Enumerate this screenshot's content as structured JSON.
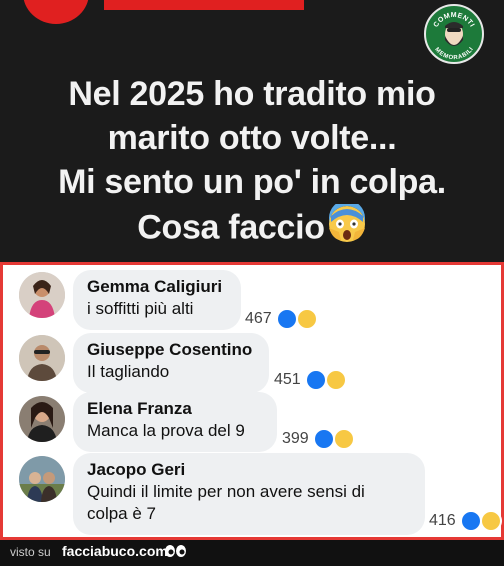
{
  "logo": {
    "text_top": "COMMENTI",
    "text_bottom": "MEMORABILI"
  },
  "post": {
    "lines": [
      "Nel 2025 ho tradito mio",
      "marito otto volte...",
      "Mi sento un po' in colpa.",
      "Cosa faccio"
    ],
    "emoji": "screaming-face-emoji"
  },
  "comments": [
    {
      "name": "Gemma Caligiuri",
      "text": "i soffitti più alti",
      "count": "467"
    },
    {
      "name": "Giuseppe Cosentino",
      "text": "Il tagliando",
      "count": "451"
    },
    {
      "name": "Elena Franza",
      "text": "Manca la prova del 9",
      "count": "399"
    },
    {
      "name": "Jacopo Geri",
      "text_lines": [
        "Quindi il limite per non avere sensi di",
        "colpa è 7"
      ],
      "count": "416"
    }
  ],
  "footer": {
    "visto": "visto su",
    "site": "facciabuco.com"
  }
}
